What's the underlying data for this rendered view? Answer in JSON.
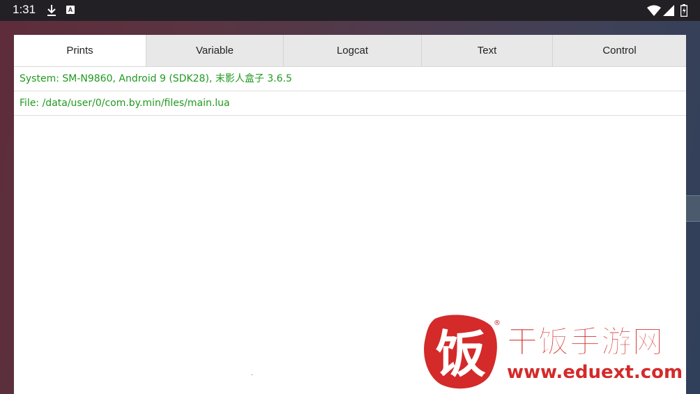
{
  "status_bar": {
    "time": "1:31",
    "icons": [
      "download-icon",
      "a-badge-icon",
      "wifi-icon",
      "signal-icon",
      "battery-icon"
    ],
    "a_badge": "A"
  },
  "tabs": [
    {
      "label": "Prints",
      "active": true
    },
    {
      "label": "Variable",
      "active": false
    },
    {
      "label": "Logcat",
      "active": false
    },
    {
      "label": "Text",
      "active": false
    },
    {
      "label": "Control",
      "active": false
    }
  ],
  "prints": [
    "System: SM-N9860, Android 9 (SDK28), 末影人盒子 3.6.5",
    "File: /data/user/0/com.by.min/files/main.lua"
  ],
  "watermark": {
    "logo_char": "饭",
    "registered": "®",
    "name": "干饭手游网",
    "url": "www.eduext.com"
  },
  "colors": {
    "print_text": "#1f9a1f",
    "active_tab_bg": "#ffffff",
    "tab_bg": "#e8e8e8",
    "watermark_red": "#d42a2a"
  }
}
